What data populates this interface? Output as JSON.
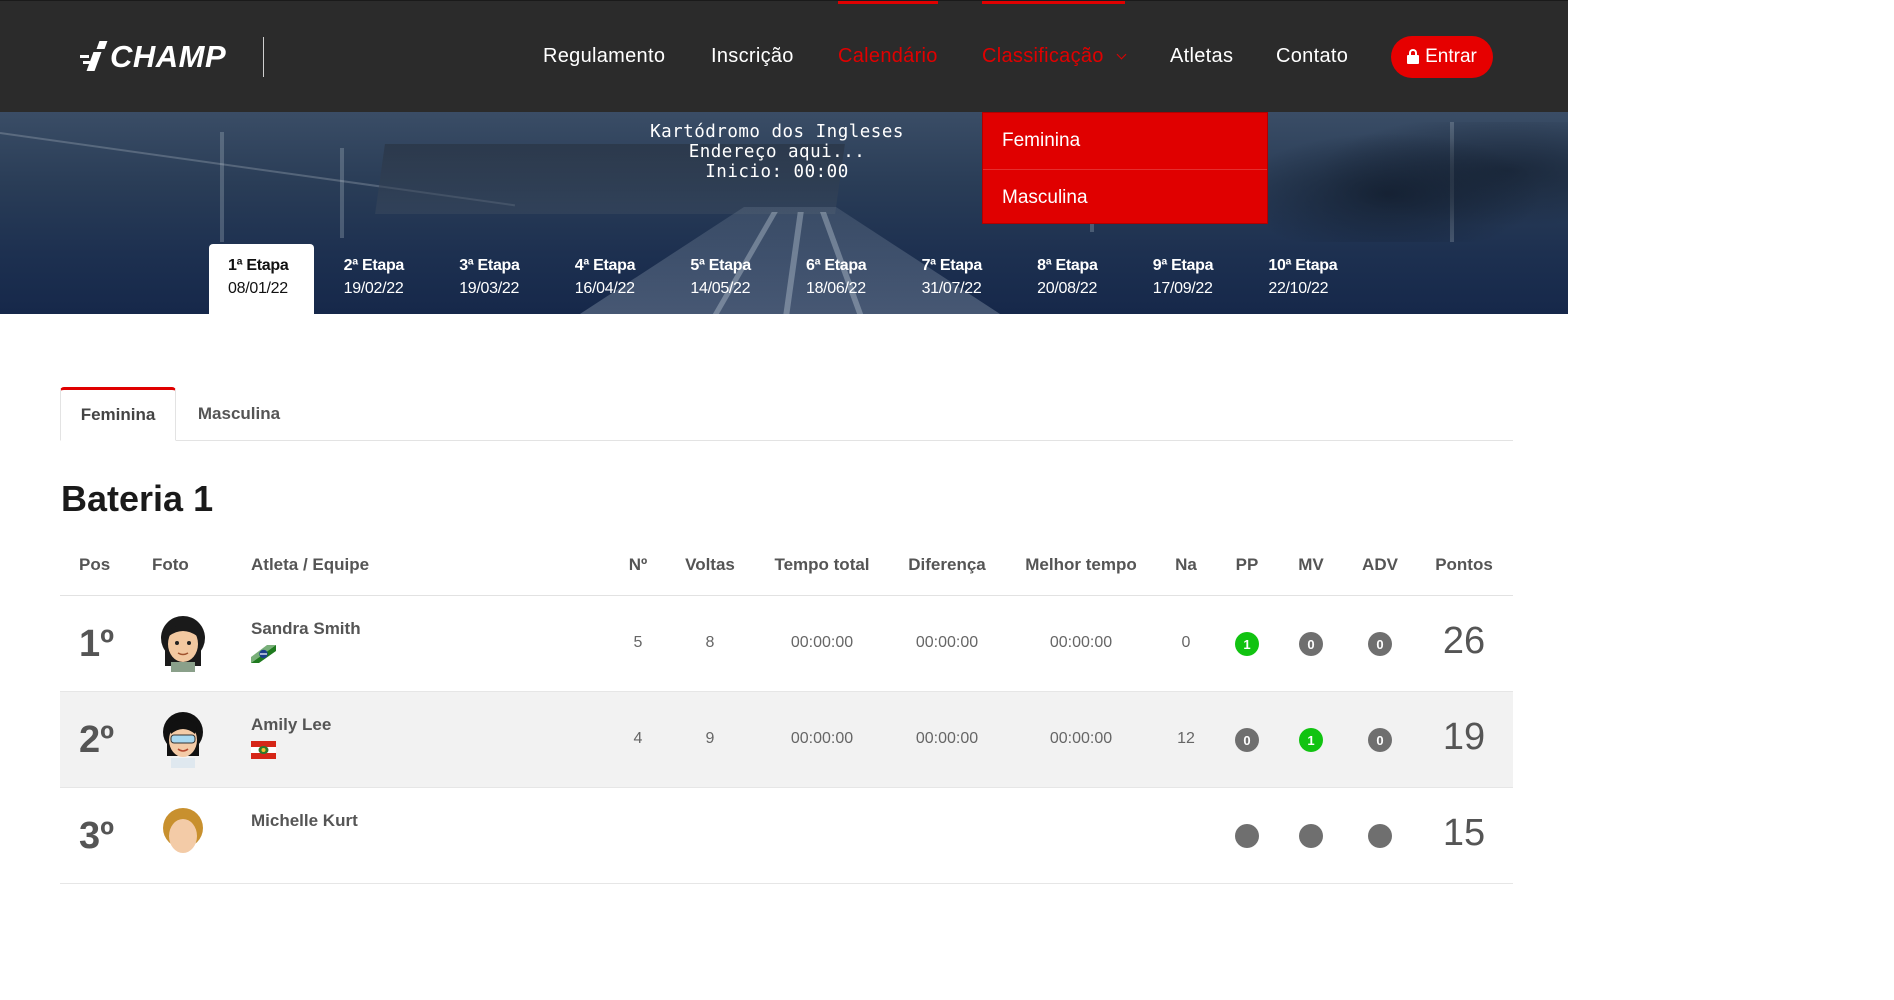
{
  "brand": {
    "logo_text": "CHAMP"
  },
  "nav": {
    "items": [
      {
        "label": "Regulamento"
      },
      {
        "label": "Inscrição"
      },
      {
        "label": "Calendário"
      },
      {
        "label": "Classificação"
      },
      {
        "label": "Atletas"
      },
      {
        "label": "Contato"
      }
    ],
    "active_items": [
      "Calendário",
      "Classificação"
    ],
    "login_label": "Entrar"
  },
  "dropdown": {
    "items": [
      "Feminina",
      "Masculina"
    ]
  },
  "venue": {
    "name": "Kartódromo dos Ingleses",
    "address": "Endereço aqui...",
    "start": "Inicio: 00:00"
  },
  "stages": [
    {
      "name": "1ª Etapa",
      "date": "08/01/22",
      "active": true
    },
    {
      "name": "2ª Etapa",
      "date": "19/02/22"
    },
    {
      "name": "3ª Etapa",
      "date": "19/03/22"
    },
    {
      "name": "4ª Etapa",
      "date": "16/04/22"
    },
    {
      "name": "5ª Etapa",
      "date": "14/05/22"
    },
    {
      "name": "6ª Etapa",
      "date": "18/06/22"
    },
    {
      "name": "7ª Etapa",
      "date": "31/07/22"
    },
    {
      "name": "8ª Etapa",
      "date": "20/08/22"
    },
    {
      "name": "9ª Etapa",
      "date": "17/09/22"
    },
    {
      "name": "10ª Etapa",
      "date": "22/10/22"
    }
  ],
  "category_tabs": {
    "female": "Feminina",
    "male": "Masculina",
    "active": "Feminina"
  },
  "heat": {
    "title": "Bateria 1"
  },
  "table": {
    "headers": {
      "pos": "Pos",
      "photo": "Foto",
      "athlete": "Atleta / Equipe",
      "number": "Nº",
      "laps": "Voltas",
      "total_time": "Tempo total",
      "gap": "Diferença",
      "best_time": "Melhor tempo",
      "na": "Na",
      "pp": "PP",
      "mv": "MV",
      "adv": "ADV",
      "points": "Pontos"
    },
    "rows": [
      {
        "pos": "1º",
        "athlete": "Sandra Smith",
        "number": "5",
        "laps": "8",
        "total_time": "00:00:00",
        "gap": "00:00:00",
        "best_time": "00:00:00",
        "na": "0",
        "pp": "1",
        "mv": "0",
        "adv": "0",
        "points": "26"
      },
      {
        "pos": "2º",
        "athlete": "Amily Lee",
        "number": "4",
        "laps": "9",
        "total_time": "00:00:00",
        "gap": "00:00:00",
        "best_time": "00:00:00",
        "na": "12",
        "pp": "0",
        "mv": "1",
        "adv": "0",
        "points": "19"
      },
      {
        "pos": "3º",
        "athlete": "Michelle Kurt",
        "number": "",
        "laps": "",
        "total_time": "",
        "gap": "",
        "best_time": "",
        "na": "",
        "pp": "",
        "mv": "",
        "adv": "",
        "points": "15"
      }
    ]
  },
  "colors": {
    "header_bg": "#2b2b2b",
    "accent": "#e00000",
    "badge_green": "#11c311",
    "badge_gray": "#6f6f6f"
  }
}
